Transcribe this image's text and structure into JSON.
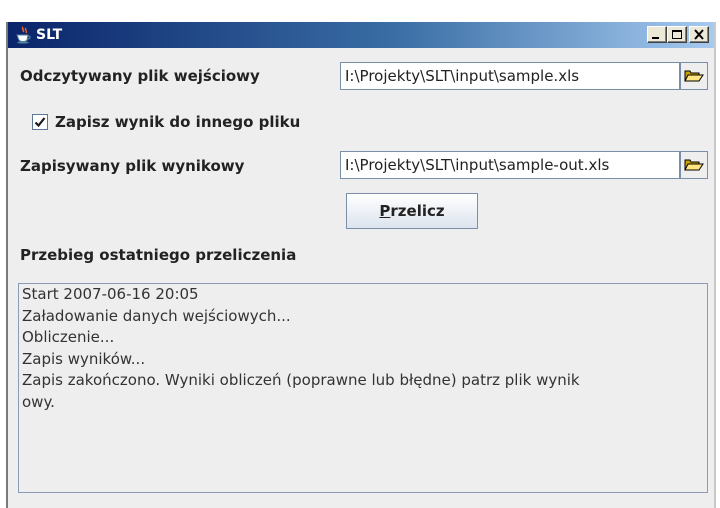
{
  "window": {
    "title": "SLT",
    "icon": "java-cup-icon",
    "controls": {
      "minimize": "minimize-icon",
      "maximize": "maximize-icon",
      "close": "close-icon"
    }
  },
  "form": {
    "input_label": "Odczytywany plik wejściowy",
    "input_path": "I:\\Projekty\\SLT\\input\\sample.xls",
    "save_checkbox_label": "Zapisz wynik do innego pliku",
    "save_checkbox_checked": true,
    "output_label": "Zapisywany plik wynikowy",
    "output_path": "I:\\Projekty\\SLT\\input\\sample-out.xls",
    "browse_icon": "open-folder-icon",
    "recalc_button": {
      "mnemonic": "P",
      "rest": "rzelicz"
    }
  },
  "log": {
    "heading": "Przebieg ostatniego przeliczenia",
    "lines": [
      "Start 2007-06-16 20:05",
      "Załadowanie danych wejściowych...",
      "Obliczenie...",
      "Zapis wyników...",
      "Zapis zakończono. Wyniki obliczeń (poprawne lub błędne) patrz plik wynik",
      "owy."
    ]
  },
  "colors": {
    "title_gradient_start": "#0a246a",
    "title_gradient_end": "#a6caf0",
    "window_background": "#eeeeee",
    "field_border": "#7a8ea8",
    "folder_icon": "#c8a000"
  }
}
